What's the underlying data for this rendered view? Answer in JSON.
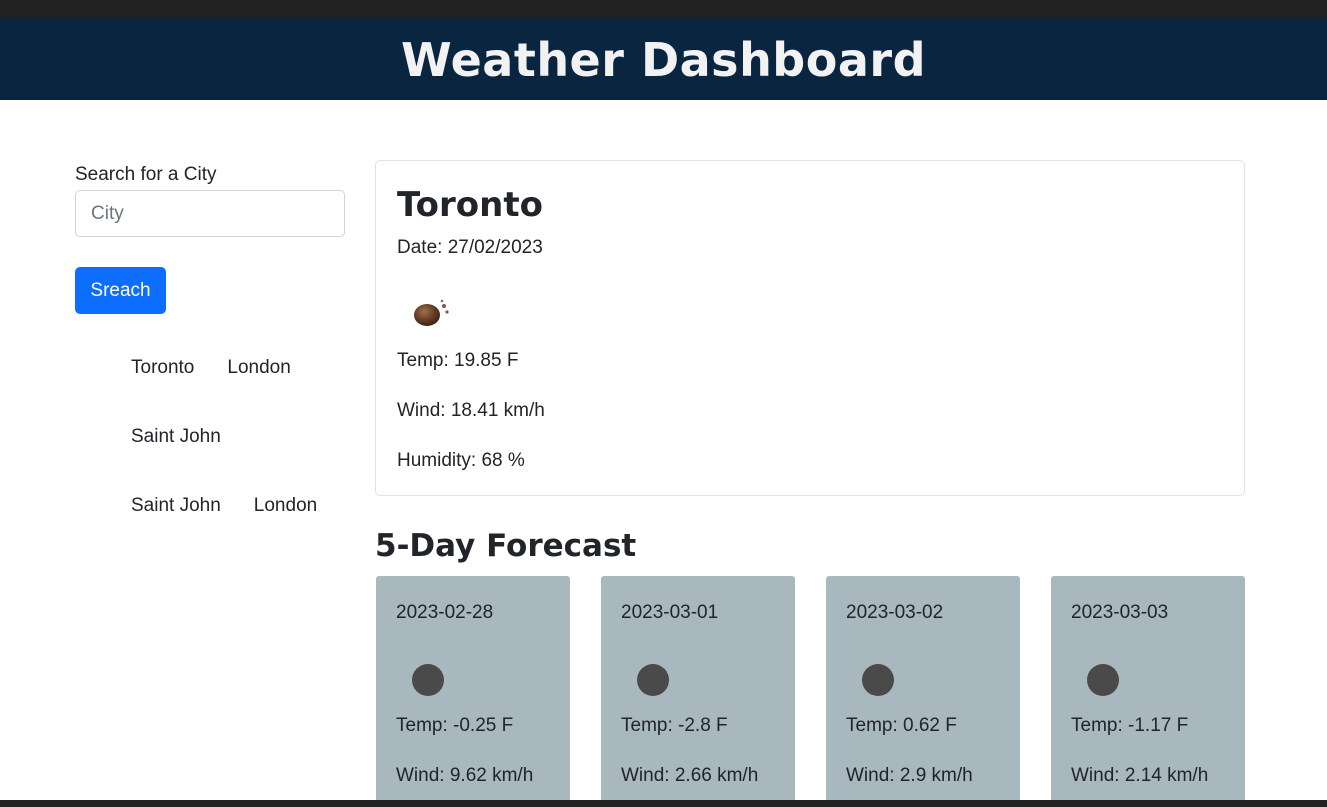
{
  "header": {
    "title": "Weather Dashboard"
  },
  "search": {
    "label": "Search for a City",
    "placeholder": "City",
    "value": "",
    "button_label": "Sreach"
  },
  "history": {
    "items": [
      "Toronto",
      "London",
      "Saint John",
      "Saint John",
      "London"
    ]
  },
  "current": {
    "city": "Toronto",
    "date": "Date: 27/02/2023",
    "icon": "weather-icon",
    "temp": "Temp: 19.85 F",
    "wind": "Wind: 18.41 km/h",
    "humidity": "Humidity: 68 %"
  },
  "forecast": {
    "title": "5-Day Forecast",
    "days": [
      {
        "date": "2023-02-28",
        "temp": "Temp: -0.25 F",
        "wind": "Wind: 9.62 km/h"
      },
      {
        "date": "2023-03-01",
        "temp": "Temp: -2.8 F",
        "wind": "Wind: 2.66 km/h"
      },
      {
        "date": "2023-03-02",
        "temp": "Temp: 0.62 F",
        "wind": "Wind: 2.9 km/h"
      },
      {
        "date": "2023-03-03",
        "temp": "Temp: -1.17 F",
        "wind": "Wind: 2.14 km/h"
      }
    ]
  },
  "colors": {
    "header_bg": "#0a2540",
    "button_bg": "#0d6efd",
    "forecast_card_bg": "#a9b7bf"
  }
}
